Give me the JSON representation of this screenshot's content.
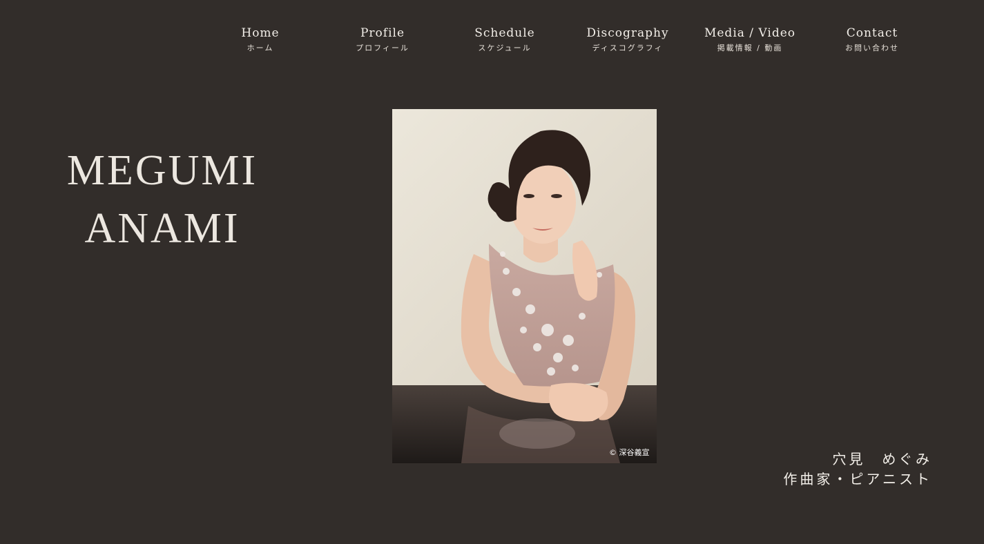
{
  "nav": {
    "items": [
      {
        "en": "Home",
        "jp": "ホーム"
      },
      {
        "en": "Profile",
        "jp": "プロフィール"
      },
      {
        "en": "Schedule",
        "jp": "スケジュール"
      },
      {
        "en": "Discography",
        "jp": "ディスコグラフィ"
      },
      {
        "en": "Media / Video",
        "jp": "掲載情報 / 動画"
      },
      {
        "en": "Contact",
        "jp": "お問い合わせ"
      }
    ]
  },
  "hero": {
    "name_line1": "MEGUMI",
    "name_line2": "ANAMI",
    "photo_credit": "© 深谷義宣",
    "jp_name": "穴見　めぐみ",
    "jp_title": "作曲家・ピアニスト"
  },
  "colors": {
    "background": "#322d2a",
    "text": "#f3efe9"
  }
}
